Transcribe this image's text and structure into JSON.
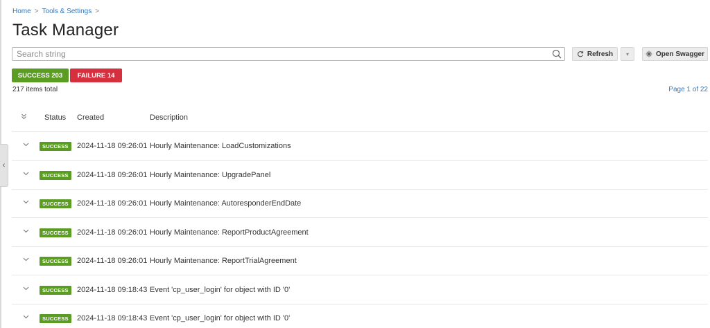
{
  "breadcrumb": {
    "home": "Home",
    "tools": "Tools & Settings",
    "sep": ">"
  },
  "page_title": "Task Manager",
  "search": {
    "placeholder": "Search string",
    "value": ""
  },
  "toolbar": {
    "refresh_label": "Refresh",
    "dropdown_glyph": "▾",
    "swagger_label": "Open Swagger"
  },
  "filters": {
    "success_label": "SUCCESS 203",
    "failure_label": "FAILURE 14"
  },
  "summary": {
    "items_total": "217 items total",
    "page_info": "Page 1 of 22"
  },
  "table": {
    "headers": {
      "expand": "»",
      "status": "Status",
      "created": "Created",
      "description": "Description"
    },
    "rows": [
      {
        "status": "SUCCESS",
        "created": "2024-11-18 09:26:01",
        "description": "Hourly Maintenance: LoadCustomizations"
      },
      {
        "status": "SUCCESS",
        "created": "2024-11-18 09:26:01",
        "description": "Hourly Maintenance: UpgradePanel"
      },
      {
        "status": "SUCCESS",
        "created": "2024-11-18 09:26:01",
        "description": "Hourly Maintenance: AutoresponderEndDate"
      },
      {
        "status": "SUCCESS",
        "created": "2024-11-18 09:26:01",
        "description": "Hourly Maintenance: ReportProductAgreement"
      },
      {
        "status": "SUCCESS",
        "created": "2024-11-18 09:26:01",
        "description": "Hourly Maintenance: ReportTrialAgreement"
      },
      {
        "status": "SUCCESS",
        "created": "2024-11-18 09:18:43",
        "description": "Event 'cp_user_login' for object with ID '0'"
      },
      {
        "status": "SUCCESS",
        "created": "2024-11-18 09:18:43",
        "description": "Event 'cp_user_login' for object with ID '0'"
      }
    ]
  },
  "colors": {
    "success": "#5b9c23",
    "failure": "#d6303f",
    "link": "#2f78c0"
  },
  "icons": {
    "search": "search-icon",
    "refresh": "refresh-icon",
    "swagger": "swagger-icon",
    "collapse": "chevron-left-icon"
  }
}
